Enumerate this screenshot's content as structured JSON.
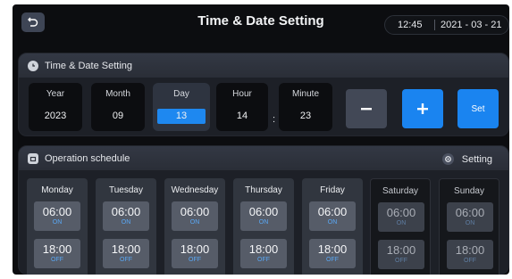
{
  "header": {
    "title": "Time & Date Setting",
    "time": "12:45",
    "date": "2021 - 03 - 21"
  },
  "time_date": {
    "section_title": "Time & Date Setting",
    "fields": [
      {
        "label": "Year",
        "value": "2023"
      },
      {
        "label": "Month",
        "value": "09"
      },
      {
        "label": "Day",
        "value": "13",
        "selected": true
      },
      {
        "label": "Hour",
        "value": "14"
      },
      {
        "label": "Minute",
        "value": "23"
      }
    ],
    "colon": ":",
    "minus_label": "−",
    "plus_label": "+",
    "set_label": "Set"
  },
  "schedule": {
    "section_title": "Operation schedule",
    "setting_label": "Setting",
    "days": [
      {
        "name": "Monday",
        "on_time": "06:00",
        "on_label": "ON",
        "off_time": "18:00",
        "off_label": "OFF",
        "active": true
      },
      {
        "name": "Tuesday",
        "on_time": "06:00",
        "on_label": "ON",
        "off_time": "18:00",
        "off_label": "OFF",
        "active": true
      },
      {
        "name": "Wednesday",
        "on_time": "06:00",
        "on_label": "ON",
        "off_time": "18:00",
        "off_label": "OFF",
        "active": true
      },
      {
        "name": "Thursday",
        "on_time": "06:00",
        "on_label": "ON",
        "off_time": "18:00",
        "off_label": "OFF",
        "active": true
      },
      {
        "name": "Friday",
        "on_time": "06:00",
        "on_label": "ON",
        "off_time": "18:00",
        "off_label": "OFF",
        "active": true
      },
      {
        "name": "Saturday",
        "on_time": "06:00",
        "on_label": "ON",
        "off_time": "18:00",
        "off_label": "OFF",
        "active": false
      },
      {
        "name": "Sunday",
        "on_time": "06:00",
        "on_label": "ON",
        "off_time": "18:00",
        "off_label": "OFF",
        "active": false
      }
    ]
  },
  "icons": {
    "back": "back-arrow-icon",
    "clock": "clock-icon",
    "calendar": "calendar-icon",
    "gear": "gear-icon"
  },
  "colors": {
    "accent": "#1a84f0",
    "background": "#0c0d10",
    "panel": "#1d2027",
    "on_state": "#5aa8f5"
  }
}
